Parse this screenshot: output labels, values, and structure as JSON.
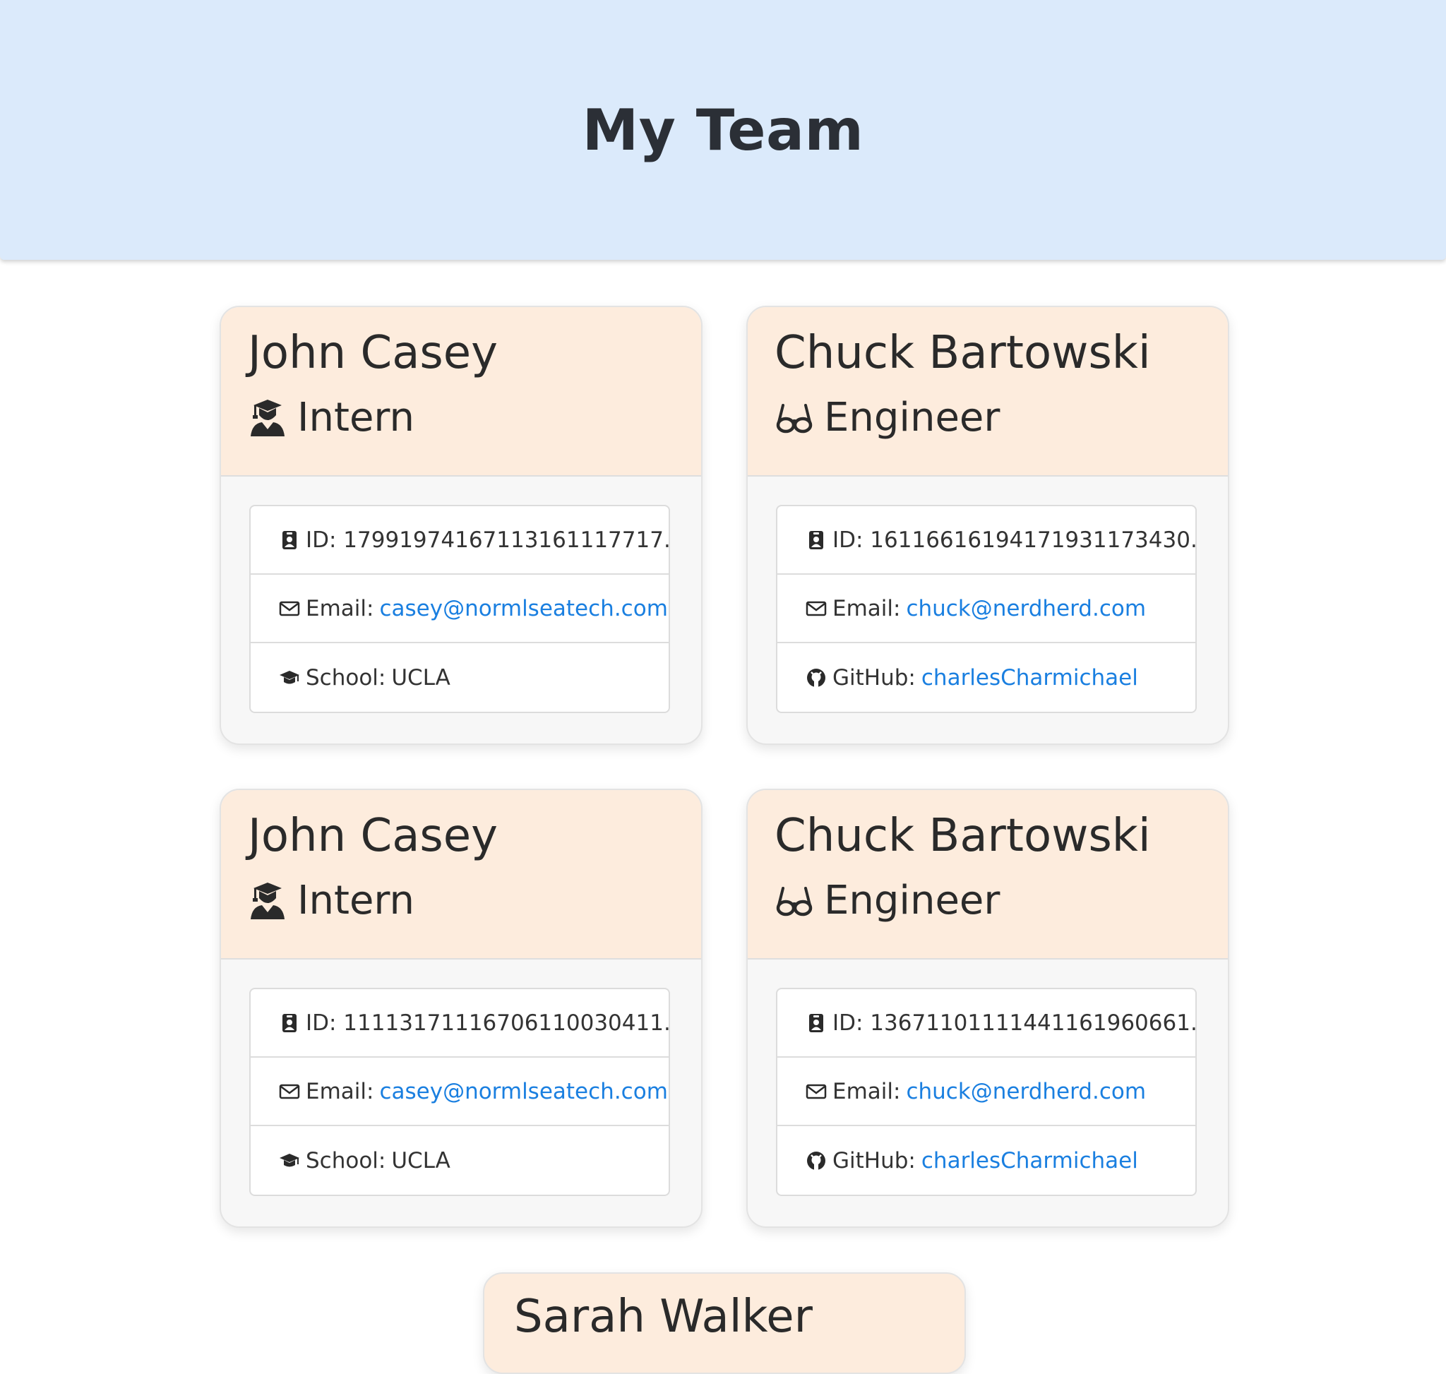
{
  "header": {
    "title": "My Team"
  },
  "cards": [
    {
      "name": "John Casey",
      "role": "Intern",
      "role_icon": "graduate-icon",
      "id_label": "ID: 17991974167113161117717...",
      "email_prefix": "Email: ",
      "email": "casey@normlseatech.com",
      "extra_prefix": "School: ",
      "extra_value": "UCLA",
      "extra_icon": "graduation-cap-icon"
    },
    {
      "name": "Chuck Bartowski",
      "role": "Engineer",
      "role_icon": "glasses-icon",
      "id_label": "ID: 16116616194171931173430...",
      "email_prefix": "Email: ",
      "email": "chuck@nerdherd.com",
      "extra_prefix": "GitHub: ",
      "extra_value": "charlesCharmichael",
      "extra_icon": "github-icon"
    },
    {
      "name": "John Casey",
      "role": "Intern",
      "role_icon": "graduate-icon",
      "id_label": "ID: 11113171116706110030411...",
      "email_prefix": "Email: ",
      "email": "casey@normlseatech.com",
      "extra_prefix": "School: ",
      "extra_value": "UCLA",
      "extra_icon": "graduation-cap-icon"
    },
    {
      "name": "Chuck Bartowski",
      "role": "Engineer",
      "role_icon": "glasses-icon",
      "id_label": "ID: 13671101111441161960661...",
      "email_prefix": "Email: ",
      "email": "chuck@nerdherd.com",
      "extra_prefix": "GitHub: ",
      "extra_value": "charlesCharmichael",
      "extra_icon": "github-icon"
    }
  ],
  "partial_card": {
    "name": "Sarah Walker"
  },
  "colors": {
    "header_bg": "#dbeafb",
    "card_head_bg": "#fdecdd",
    "link": "#1a7fe0"
  }
}
